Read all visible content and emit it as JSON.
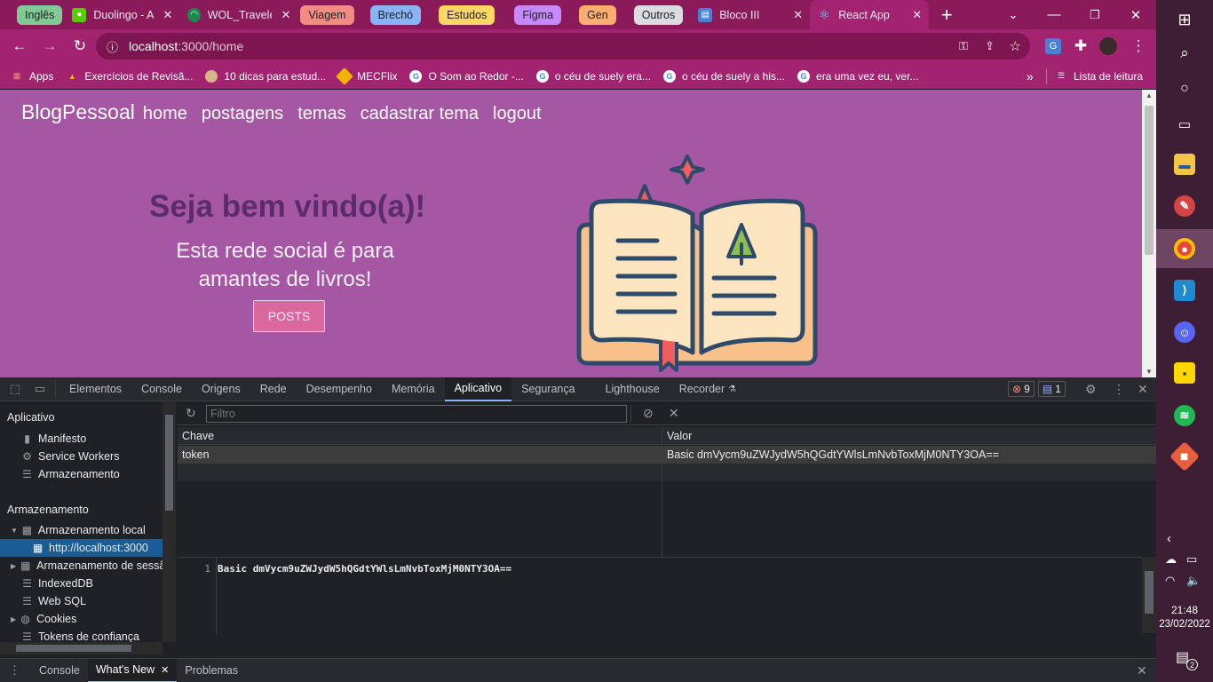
{
  "browser": {
    "tab_groups": [
      {
        "label": "Inglês",
        "color": "#81c995"
      },
      {
        "label": "Viagem",
        "color": "#f28b82"
      },
      {
        "label": "Brechó",
        "color": "#8ab4f8"
      },
      {
        "label": "Estudos",
        "color": "#fdd663"
      },
      {
        "label": "Figma",
        "color": "#c58af9"
      },
      {
        "label": "Gen",
        "color": "#fcad70"
      },
      {
        "label": "Outros",
        "color": "#dadce0"
      }
    ],
    "tabs": [
      {
        "title": "Duolingo - A",
        "icon": "duolingo-icon"
      },
      {
        "title": "WOL_Traveler",
        "icon": "wol-icon"
      },
      {
        "title": "Bloco III",
        "icon": "document-icon"
      },
      {
        "title": "React App",
        "icon": "react-icon",
        "active": true
      }
    ],
    "new_tab_symbol": "+",
    "url_host": "localhost",
    "url_path": ":3000/home",
    "bookmarks": [
      {
        "label": "Apps",
        "icon": "apps-grid-icon"
      },
      {
        "label": "Exercícios de Revisã...",
        "icon": "drive-icon"
      },
      {
        "label": "10 dicas para estud...",
        "icon": "avatar-icon"
      },
      {
        "label": "MECFlix",
        "icon": "mecflix-icon"
      },
      {
        "label": "O Som ao Redor -...",
        "icon": "google-icon"
      },
      {
        "label": "o céu de suely era...",
        "icon": "google-icon"
      },
      {
        "label": "o céu de suely a his...",
        "icon": "google-icon"
      },
      {
        "label": "era uma vez eu, ver...",
        "icon": "google-icon"
      }
    ],
    "reading_list": "Lista de leitura"
  },
  "page": {
    "brand": "BlogPessoal",
    "nav": [
      "home",
      "postagens",
      "temas",
      "cadastrar tema",
      "logout"
    ],
    "hero_title": "Seja bem vindo(a)!",
    "hero_line1": "Esta rede social é para",
    "hero_line2": "amantes de livros!",
    "posts_button": "POSTS",
    "background": "#a557a4"
  },
  "devtools": {
    "tabs": [
      "Elementos",
      "Console",
      "Origens",
      "Rede",
      "Desempenho",
      "Memória",
      "Aplicativo",
      "Segurança",
      "Lighthouse",
      "Recorder"
    ],
    "active_tab": "Aplicativo",
    "errors": "9",
    "messages": "1",
    "sidebar": {
      "section1": "Aplicativo",
      "app_items": [
        "Manifesto",
        "Service Workers",
        "Armazenamento"
      ],
      "section2": "Armazenamento",
      "storage_items": [
        "Armazenamento local",
        "http://localhost:3000",
        "Armazenamento de sessão",
        "IndexedDB",
        "Web SQL",
        "Cookies",
        "Tokens de confiança"
      ]
    },
    "filter_placeholder": "Filtro",
    "table": {
      "headers": [
        "Chave",
        "Valor"
      ],
      "rows": [
        {
          "key": "token",
          "value": "Basic dmVycm9uZWJydW5hQGdtYWlsLmNvbToxMjM0NTY3OA=="
        }
      ]
    },
    "preview_line": "1",
    "preview_value": "Basic dmVycm9uZWJydW5hQGdtYWlsLmNvbToxMjM0NTY3OA==",
    "drawer_tabs": [
      "Console",
      "What's New",
      "Problemas"
    ],
    "drawer_active": "What's New"
  },
  "taskbar": {
    "time": "21:48",
    "date": "23/02/2022",
    "notifications": "2"
  }
}
